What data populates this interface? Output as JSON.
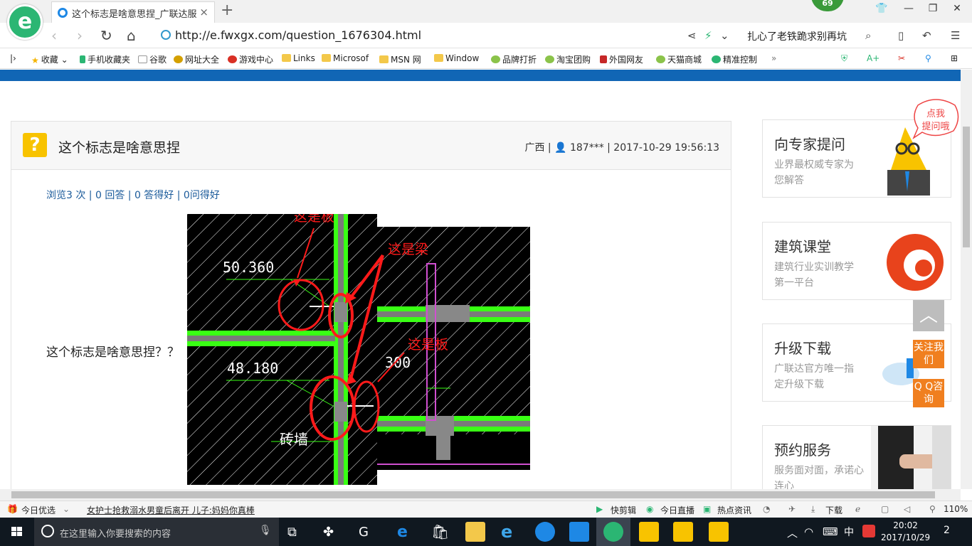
{
  "browser": {
    "tab_title": "这个标志是啥意思捏_广联达服务",
    "tab_close": "×",
    "new_tab": "+",
    "badge_count": "69",
    "url": "http://e.fwxgx.com/question_1676304.html",
    "news_headline": "扎心了老铁跪求别再坑",
    "logo": "e"
  },
  "bookmarks": [
    "收藏",
    "手机收藏夹",
    "谷歌",
    "网址大全",
    "游戏中心",
    "Links",
    "Microsof",
    "MSN 网",
    "Window",
    "品牌打折",
    "淘宝团购",
    "外国网友",
    "天猫商城",
    "精准控制"
  ],
  "question": {
    "icon": "?",
    "title": "这个标志是啥意思捏",
    "meta": "广西 | 👤 187*** | 2017-10-29 19:56:13",
    "stats": "浏览3 次 | 0 回答 | 0 答得好 | 0问得好",
    "body": "这个标志是啥意思捏？？"
  },
  "cad": {
    "label_ban_top": "这是板",
    "label_liang": "这是梁",
    "label_ban_mid": "这是板",
    "elev1": "50.360",
    "elev2": "48.180",
    "dim": "300",
    "wall": "砖墙"
  },
  "sidebar": [
    {
      "title": "向专家提问",
      "desc": "业界最权威专家为您解答"
    },
    {
      "title": "建筑课堂",
      "desc": "建筑行业实训教学第一平台"
    },
    {
      "title": "升级下载",
      "desc": "广联达官方唯一指定升级下载"
    },
    {
      "title": "预约服务",
      "desc": "服务面对面，承诺心连心"
    }
  ],
  "bubble": "点我提问哦",
  "float": {
    "top": "︿",
    "follow": "关注我们",
    "qq": "Q Q咨询"
  },
  "statusbar": {
    "today": "今日优选",
    "news": "女护士抢救溺水男童后离开 儿子:妈妈你真棒",
    "kuaijian": "快剪辑",
    "zhibo": "今日直播",
    "redian": "热点资讯",
    "download": "下载",
    "zoom": "110%"
  },
  "taskbar": {
    "search_placeholder": "在这里输入你要搜索的内容",
    "ime": "中",
    "time": "20:02",
    "date": "2017/10/29",
    "notifications": "2"
  },
  "colors": {
    "brand_blue": "#1166b5",
    "accent_orange": "#f07f1f",
    "cad_green": "#39ff14",
    "cad_red": "#ff1a1a"
  }
}
